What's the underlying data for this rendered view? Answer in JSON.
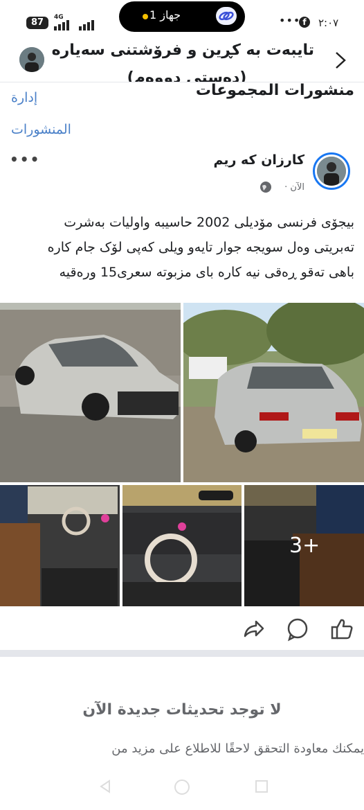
{
  "status_bar": {
    "battery": "87",
    "network": "4G",
    "island_text": "1 جهاز",
    "time": "٢:٠٧"
  },
  "group": {
    "title_line1": "تایبەت بە کڕین و فرۆشتنی سەیارەی",
    "title_line2": "(دەستی دووەم)"
  },
  "section": {
    "title": "منشورات المجموعات",
    "manage_label": "إدارة المنشورات"
  },
  "post": {
    "author": "كارزان كه ريم",
    "time": "الآن ·",
    "text_line1": "بيجۆی فرنسی مۆديلی 2002 حاسيبه واوليات بەشرت",
    "text_line2": "تەبريتی وەل سويجه جوار تايەو ويلی کەپی لۆک جام کاره",
    "text_line3": "باهی تەقو ڕەقی نيه کاره بای مزبوته سعری15 ورەقيه",
    "more_photos": "3+"
  },
  "actions": {
    "like": "like-icon",
    "comment": "comment-icon",
    "share": "share-icon"
  },
  "feed_end": {
    "title": "لا توجد تحديثات جديدة الآن",
    "subtitle": "يمكنك معاودة التحقق لاحقًا للاطلاع على مزيد من"
  },
  "colors": {
    "accent": "#1877f2",
    "link": "#4a80c8",
    "muted": "#65676b"
  }
}
